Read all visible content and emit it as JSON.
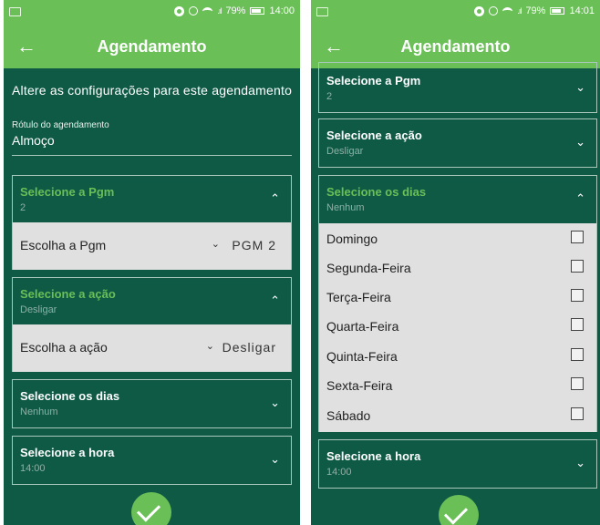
{
  "status_left": {
    "battery": "79%",
    "time": "14:00"
  },
  "status_right": {
    "battery": "79%",
    "time": "14:01"
  },
  "app_bar": {
    "title": "Agendamento"
  },
  "intro_text": "Altere as configurações para este agendamento",
  "label_field": {
    "label": "Rótulo do agendamento",
    "value": "Almoço"
  },
  "left": {
    "pgm": {
      "title": "Selecione a Pgm",
      "value": "2",
      "row_label": "Escolha a Pgm",
      "row_value": "PGM 2"
    },
    "acao": {
      "title": "Selecione a ação",
      "value": "Desligar",
      "row_label": "Escolha a ação",
      "row_value": "Desligar"
    },
    "dias": {
      "title": "Selecione os dias",
      "value": "Nenhum"
    },
    "hora": {
      "title": "Selecione a hora",
      "value": "14:00"
    }
  },
  "right": {
    "pgm": {
      "title": "Selecione a Pgm",
      "value": "2"
    },
    "acao": {
      "title": "Selecione a ação",
      "value": "Desligar"
    },
    "dias": {
      "title": "Selecione os dias",
      "value": "Nenhum",
      "days": [
        "Domingo",
        "Segunda-Feira",
        "Terça-Feira",
        "Quarta-Feira",
        "Quinta-Feira",
        "Sexta-Feira",
        "Sábado"
      ]
    },
    "hora": {
      "title": "Selecione a hora",
      "value": "14:00"
    }
  },
  "icons": {
    "back": "arrow-left-icon",
    "expand": "chevron-down-icon",
    "collapse": "chevron-up-icon",
    "confirm": "check-icon"
  },
  "colors": {
    "primary": "#6abf57",
    "background": "#0e5a45",
    "row": "#e0e0e0"
  }
}
